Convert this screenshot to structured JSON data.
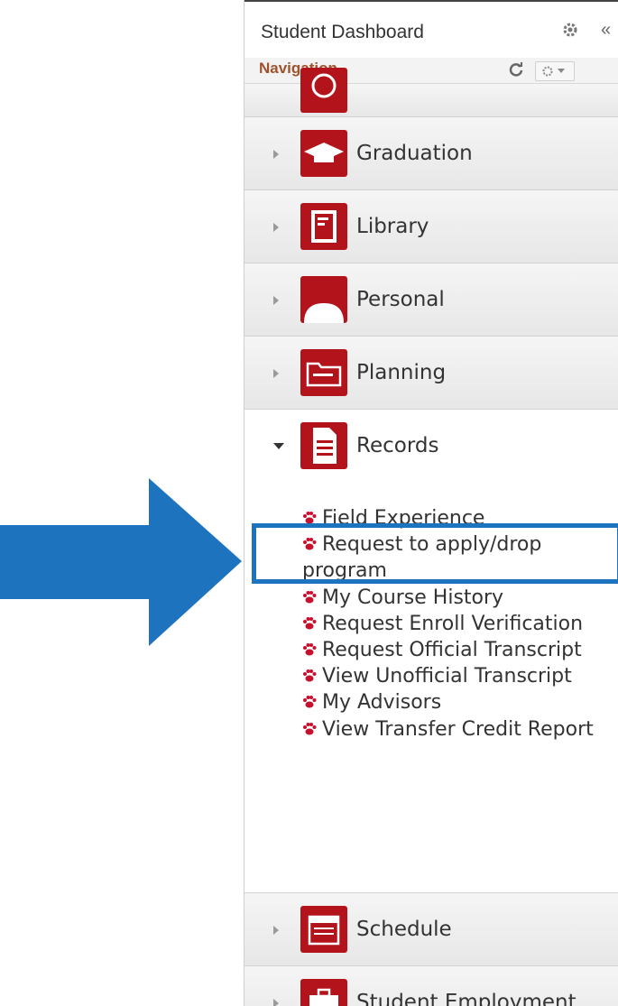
{
  "header": {
    "title": "Student Dashboard",
    "settings_icon": "gear-icon",
    "collapse_glyph": "«"
  },
  "navigation": {
    "title": "Navigation",
    "refresh_icon": "refresh-icon",
    "menu_icon": "gear-dropdown-icon"
  },
  "categories": [
    {
      "label": "Graduation",
      "icon": "graduation-cap-icon",
      "expanded": false
    },
    {
      "label": "Library",
      "icon": "book-icon",
      "expanded": false
    },
    {
      "label": "Personal",
      "icon": "person-icon",
      "expanded": false
    },
    {
      "label": "Planning",
      "icon": "folder-icon",
      "expanded": false
    },
    {
      "label": "Records",
      "icon": "document-icon",
      "expanded": true
    },
    {
      "label": "Schedule",
      "icon": "calendar-icon",
      "expanded": false
    },
    {
      "label": "Student Employment",
      "icon": "briefcase-icon",
      "expanded": false
    }
  ],
  "records_links": [
    "Field Experience",
    "Request to apply/drop program",
    "My Course History",
    "Request Enroll Verification",
    "Request Official Transcript",
    "View Unofficial Transcript",
    "My Advisors",
    "View Transfer Credit Report"
  ],
  "annotation": {
    "highlighted_link": "Request to apply/drop program",
    "arrow_color": "#1e73be",
    "box_color": "#1e73be"
  },
  "colors": {
    "icon_red": "#b3141b",
    "nav_title": "#a0522d",
    "paw": "#c8102e"
  }
}
